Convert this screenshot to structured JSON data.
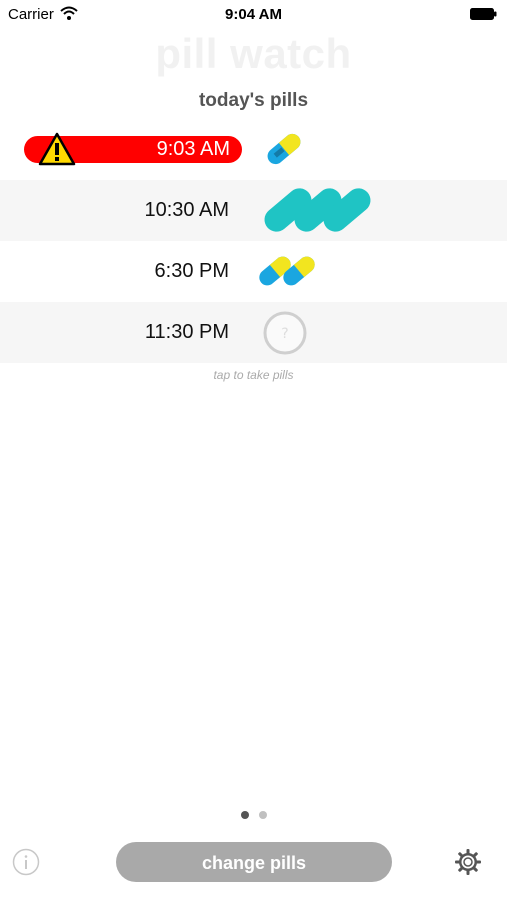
{
  "status_bar": {
    "carrier": "Carrier",
    "time": "9:04 AM"
  },
  "app_title": "pill watch",
  "section_title": "today's pills",
  "doses": [
    {
      "time": "9:03 AM",
      "status": "overdue",
      "pill_icon": "capsule-yellow-blue",
      "pill_count": 1
    },
    {
      "time": "10:30 AM",
      "status": "scheduled",
      "pill_icon": "capsule-teal",
      "pill_count": 3
    },
    {
      "time": "6:30 PM",
      "status": "scheduled",
      "pill_icon": "capsule-yellow-blue",
      "pill_count": 2
    },
    {
      "time": "11:30 PM",
      "status": "scheduled",
      "pill_icon": "unknown-pill-circle",
      "pill_count": 1
    }
  ],
  "hint": "tap to take pills",
  "page_indicator": {
    "pages": 2,
    "current": 1
  },
  "bottom_bar": {
    "change_label": "change pills",
    "info_icon": "info-icon",
    "settings_icon": "gear-icon"
  },
  "colors": {
    "alert": "#ff0000",
    "teal": "#1fc4c4",
    "capsule_yellow": "#f2e51f",
    "capsule_blue": "#1aa6e0"
  }
}
